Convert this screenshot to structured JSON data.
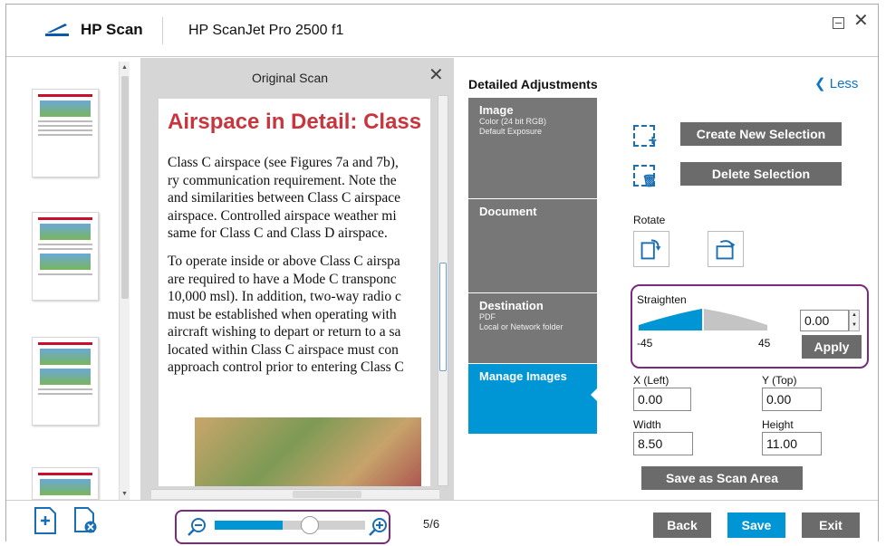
{
  "titlebar": {
    "app_name": "HP Scan",
    "device_name": "HP ScanJet Pro 2500 f1"
  },
  "preview": {
    "title": "Original Scan",
    "doc_heading": "Airspace in Detail: Class",
    "doc_para1": "Class C airspace (see Figures 7a and 7b),\nry communication requirement. Note the\nand similarities between Class C airspace\nairspace. Controlled airspace weather mi\nsame for Class C and Class D airspace.",
    "doc_para2": "To operate inside or above Class C airspa\nare required to have a Mode C transponc\n10,000 msl). In addition, two-way radio c\nmust be established when operating with\naircraft wishing to depart or return to a sa\nlocated within Class C airspace must con\napproach control prior to entering Class C",
    "page_indicator": "5/6"
  },
  "adjustments": {
    "title": "Detailed Adjustments",
    "less_label": "Less",
    "tabs": [
      {
        "title": "Image",
        "sub1": "Color (24 bit RGB)",
        "sub2": "Default Exposure"
      },
      {
        "title": "Document",
        "sub1": "",
        "sub2": ""
      },
      {
        "title": "Destination",
        "sub1": "PDF",
        "sub2": "Local or Network folder"
      },
      {
        "title": "Manage Images",
        "sub1": "",
        "sub2": ""
      }
    ],
    "create_selection": "Create New Selection",
    "delete_selection": "Delete Selection",
    "rotate_label": "Rotate",
    "straighten_label": "Straighten",
    "straighten_value": "0.00",
    "straighten_min": "-45",
    "straighten_max": "45",
    "apply_label": "Apply",
    "x_label": "X (Left)",
    "x_value": "0.00",
    "y_label": "Y (Top)",
    "y_value": "0.00",
    "width_label": "Width",
    "width_value": "8.50",
    "height_label": "Height",
    "height_value": "11.00",
    "save_area": "Save as Scan Area"
  },
  "bottom": {
    "back": "Back",
    "save": "Save",
    "exit": "Exit",
    "zoom_level": 0.45
  },
  "colors": {
    "accent": "#0096d6",
    "tab_gray": "#777777",
    "highlight": "#7a2b7f",
    "brand_red": "#c8363d"
  }
}
